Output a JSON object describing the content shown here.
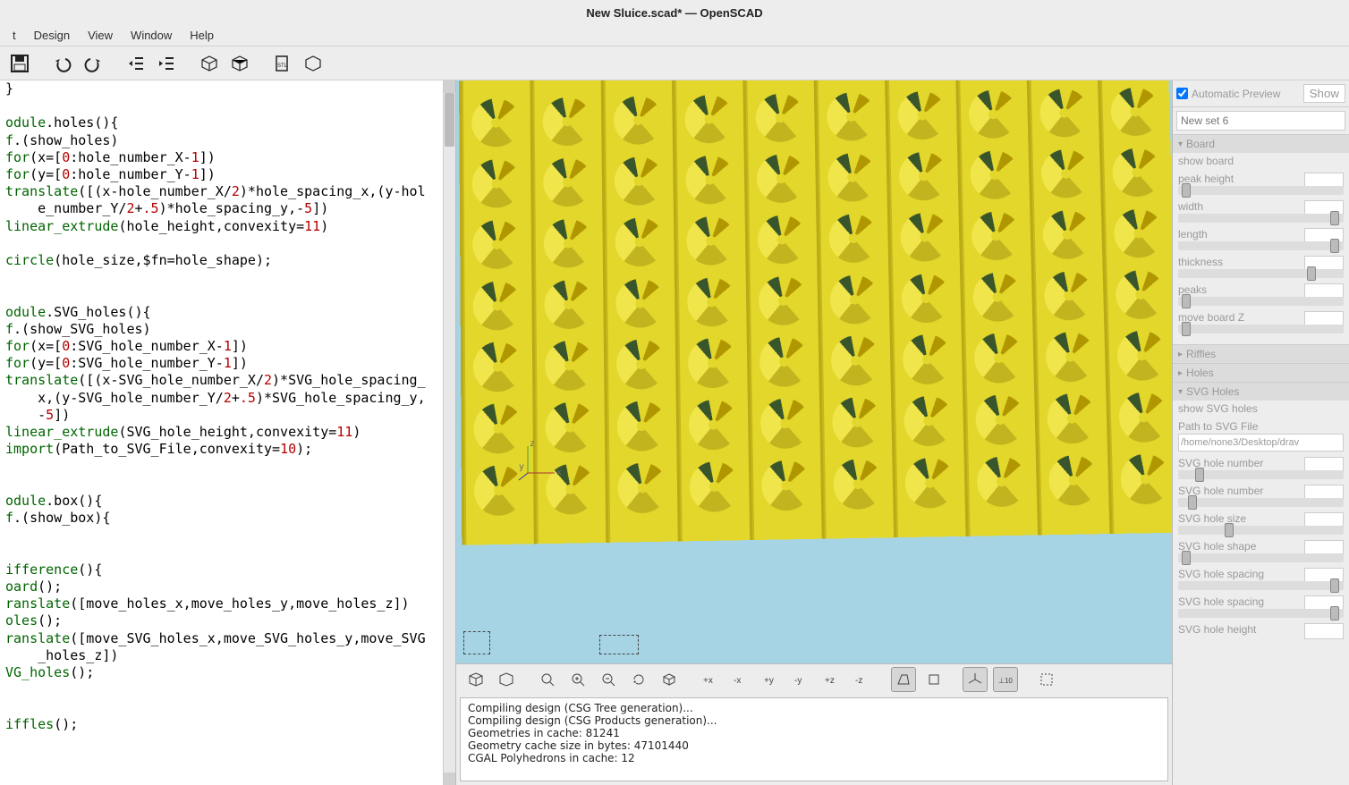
{
  "window": {
    "title": "New Sluice.scad* — OpenSCAD"
  },
  "menu": {
    "items": [
      "t",
      "Design",
      "View",
      "Window",
      "Help"
    ]
  },
  "customizer": {
    "auto_preview": "Automatic Preview",
    "show_btn": "Show",
    "set_placeholder": "New set 6",
    "groups": {
      "board": {
        "title": "Board",
        "show_board": "show board",
        "peak_height": "peak height",
        "width": "width",
        "length": "length",
        "thickness": "thickness",
        "peaks": "peaks",
        "move_board_z": "move board Z"
      },
      "riffles": {
        "title": "Riffles"
      },
      "holes": {
        "title": "Holes"
      },
      "svg_holes": {
        "title": "SVG Holes",
        "show_svg": "show SVG holes",
        "path_label": "Path to SVG File",
        "path_value": "/home/none3/Desktop/drav",
        "svg_num_x": "SVG hole number",
        "svg_num_y": "SVG hole number",
        "svg_size": "SVG hole size",
        "svg_shape": "SVG hole shape",
        "svg_spacing_x": "SVG hole spacing",
        "svg_spacing_y": "SVG hole spacing",
        "svg_height": "SVG hole height"
      }
    }
  },
  "console": {
    "lines": [
      "Compiling design (CSG Tree generation)...",
      "Compiling design (CSG Products generation)...",
      "Geometries in cache: 81241",
      "Geometry cache size in bytes: 47101440",
      "CGAL Polyhedrons in cache: 12"
    ]
  },
  "code": {
    "l0": "}",
    "l1": "",
    "l2a": "odule",
    "l2b": ".holes(){",
    "l3a": "f",
    "l3b": ".(show_holes)",
    "l4a": "for",
    "l4b": "(x=[",
    "l4c": "0",
    "l4d": ":hole_number_X-",
    "l4e": "1",
    "l4f": "])",
    "l5a": "for",
    "l5b": "(y=[",
    "l5c": "0",
    "l5d": ":hole_number_Y-",
    "l5e": "1",
    "l5f": "])",
    "l6a": "translate",
    "l6b": "([(x-hole_number_X/",
    "l6c": "2",
    "l6d": ")*hole_spacing_x,(y-hol",
    "l7a": "    e_number_Y/",
    "l7b": "2",
    "l7c": "+",
    "l7d": ".5",
    "l7e": ")*hole_spacing_y,-",
    "l7f": "5",
    "l7g": "])",
    "l8a": "linear_extrude",
    "l8b": "(hole_height,convexity=",
    "l8c": "11",
    "l8d": ")",
    "l9": "",
    "l10a": "circle",
    "l10b": "(hole_size,$fn=hole_shape);",
    "l11": "",
    "l12": "",
    "l13a": "odule",
    "l13b": ".SVG_holes(){",
    "l14a": "f",
    "l14b": ".(show_SVG_holes)",
    "l15a": "for",
    "l15b": "(x=[",
    "l15c": "0",
    "l15d": ":SVG_hole_number_X-",
    "l15e": "1",
    "l15f": "])",
    "l16a": "for",
    "l16b": "(y=[",
    "l16c": "0",
    "l16d": ":SVG_hole_number_Y-",
    "l16e": "1",
    "l16f": "])",
    "l17a": "translate",
    "l17b": "([(x-SVG_hole_number_X/",
    "l17c": "2",
    "l17d": ")*SVG_hole_spacing_",
    "l18a": "    x,(y-SVG_hole_number_Y/",
    "l18b": "2",
    "l18c": "+",
    "l18d": ".5",
    "l18e": ")*SVG_hole_spacing_y,",
    "l19a": "    -",
    "l19b": "5",
    "l19c": "])",
    "l20a": "linear_extrude",
    "l20b": "(SVG_hole_height,convexity=",
    "l20c": "11",
    "l20d": ")",
    "l21a": "import",
    "l21b": "(Path_to_SVG_File,convexity=",
    "l21c": "10",
    "l21d": ");",
    "l22": "",
    "l23": "",
    "l24a": "odule",
    "l24b": ".box(){",
    "l25a": "f",
    "l25b": ".(show_box){",
    "l26": "",
    "l27": "",
    "l28a": "ifference",
    "l28b": "(){",
    "l29a": "oard",
    "l29b": "();",
    "l30a": "ranslate",
    "l30b": "([move_holes_x,move_holes_y,move_holes_z])",
    "l31a": "oles",
    "l31b": "();",
    "l32a": "ranslate",
    "l32b": "([move_SVG_holes_x,move_SVG_holes_y,move_SVG",
    "l33": "    _holes_z])",
    "l34a": "VG_holes",
    "l34b": "();",
    "l35": "",
    "l36": "",
    "l37a": "iffles",
    "l37b": "();"
  }
}
